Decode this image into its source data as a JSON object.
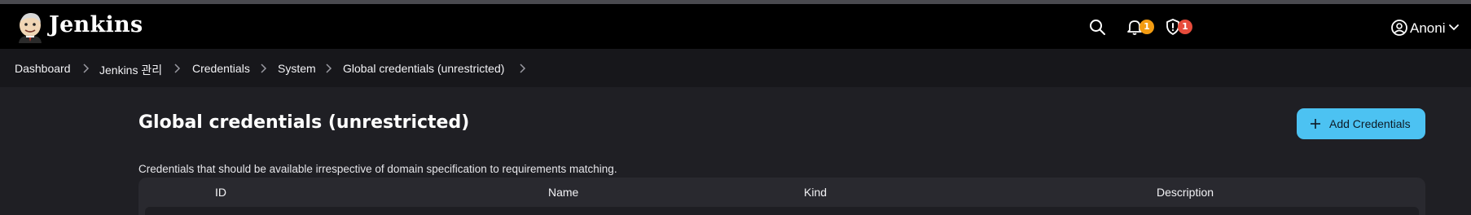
{
  "header": {
    "brand": "Jenkins",
    "notifications_count": "1",
    "security_count": "1",
    "user_name": "Anoni",
    "colors": {
      "notification_badge": "#f39c12",
      "security_badge": "#e74c3c"
    }
  },
  "breadcrumbs": [
    {
      "label": "Dashboard"
    },
    {
      "label": "Jenkins 관리"
    },
    {
      "label": "Credentials"
    },
    {
      "label": "System"
    },
    {
      "label": "Global credentials (unrestricted)"
    }
  ],
  "main": {
    "title": "Global credentials (unrestricted)",
    "add_button_label": "Add Credentials",
    "description": "Credentials that should be available irrespective of domain specification to requirements matching.",
    "accent_color": "#4cc2f2"
  },
  "table": {
    "columns": [
      "ID",
      "Name",
      "Kind",
      "Description"
    ]
  }
}
